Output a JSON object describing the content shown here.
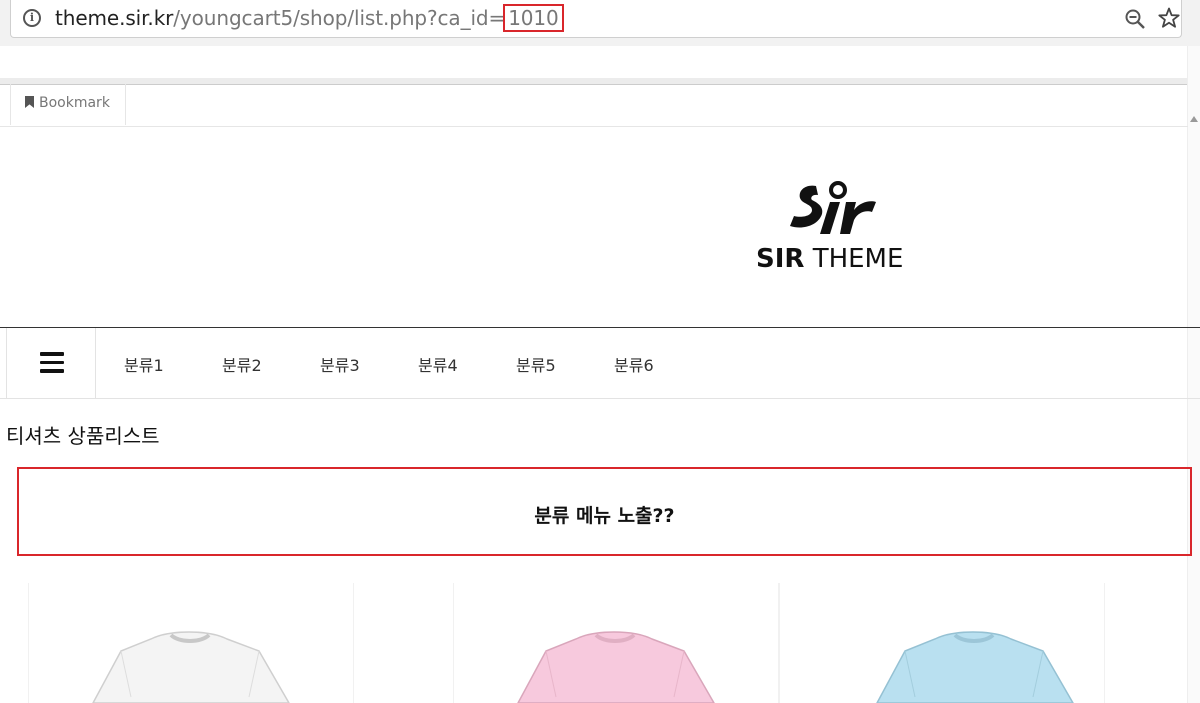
{
  "browser": {
    "url_host": "theme.sir.kr",
    "url_path": "/youngcart5/shop/list.php?ca_id=",
    "url_highlight": "1010"
  },
  "bookmark": {
    "label": "Bookmark"
  },
  "logo": {
    "text_bold": "SIR",
    "text_light": "THEME"
  },
  "nav": {
    "items": [
      {
        "label": "분류1"
      },
      {
        "label": "분류2"
      },
      {
        "label": "분류3"
      },
      {
        "label": "분류4"
      },
      {
        "label": "분류5"
      },
      {
        "label": "분류6"
      }
    ]
  },
  "page": {
    "title": "티셔츠 상품리스트"
  },
  "notice": {
    "text": "분류 메뉴 노출??"
  },
  "products": [
    {
      "color": "#f4f4f4",
      "icon": "tshirt-white-icon"
    },
    {
      "color": "#f7c9dd",
      "icon": "tshirt-pink-icon"
    },
    {
      "color": "#b9e0f0",
      "icon": "tshirt-blue-icon"
    }
  ],
  "colors": {
    "highlight": "#d9262b",
    "nav_border": "#333333"
  }
}
